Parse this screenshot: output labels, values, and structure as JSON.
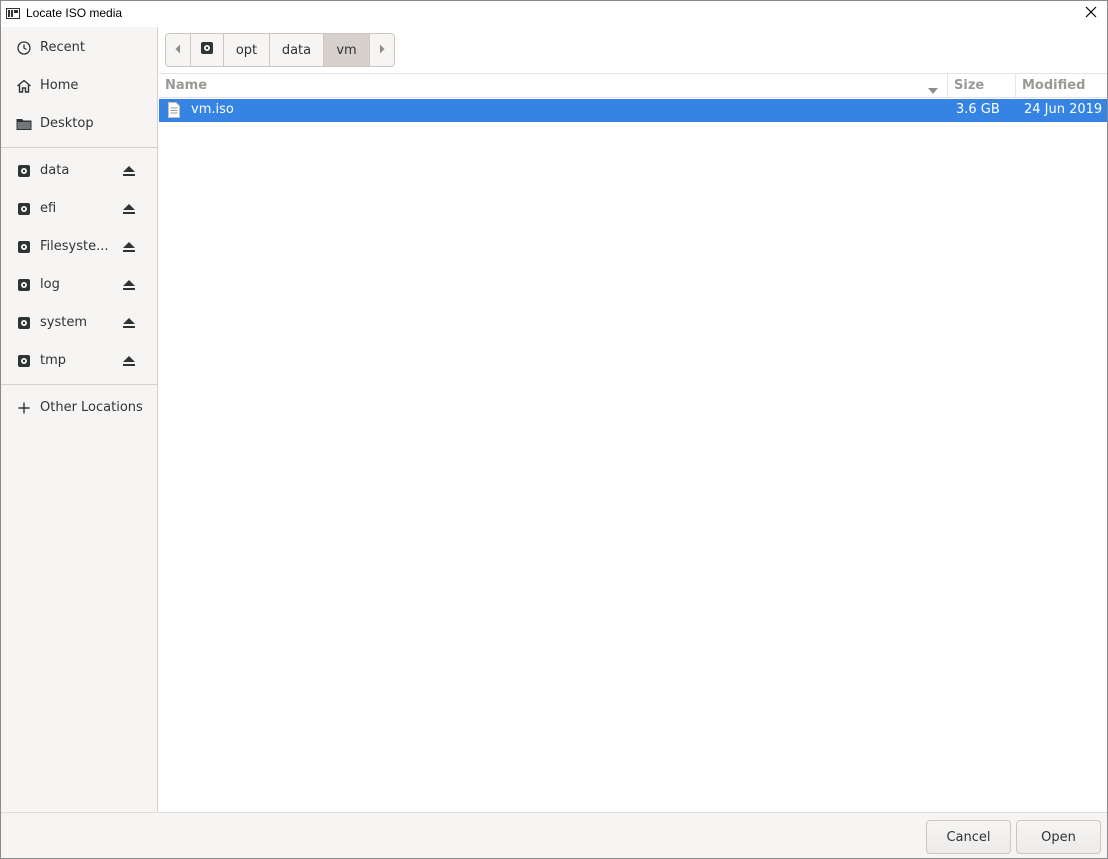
{
  "window": {
    "title": "Locate ISO media",
    "app_icon": "virt-manager-icon",
    "close_icon": "close-icon"
  },
  "sidebar": {
    "places": [
      {
        "label": "Recent",
        "icon": "clock-icon"
      },
      {
        "label": "Home",
        "icon": "home-icon"
      },
      {
        "label": "Desktop",
        "icon": "folder-icon"
      }
    ],
    "devices": [
      {
        "label": "data",
        "icon": "drive-icon",
        "eject": "eject-icon"
      },
      {
        "label": "efi",
        "icon": "drive-icon",
        "eject": "eject-icon"
      },
      {
        "label": "Filesyste...",
        "icon": "drive-icon",
        "eject": "eject-icon"
      },
      {
        "label": "log",
        "icon": "drive-icon",
        "eject": "eject-icon"
      },
      {
        "label": "system",
        "icon": "drive-icon",
        "eject": "eject-icon"
      },
      {
        "label": "tmp",
        "icon": "drive-icon",
        "eject": "eject-icon"
      }
    ],
    "other": {
      "label": "Other Locations",
      "icon": "plus-icon"
    }
  },
  "pathbar": {
    "segments": [
      "opt",
      "data",
      "vm"
    ],
    "active": "vm"
  },
  "filelist": {
    "columns": {
      "name": "Name",
      "size": "Size",
      "modified": "Modified"
    },
    "rows": [
      {
        "name": "vm.iso",
        "size": "3.6 GB",
        "modified": "24 Jun 2019",
        "selected": true
      }
    ]
  },
  "buttons": {
    "cancel": "Cancel",
    "open": "Open"
  },
  "colors": {
    "selection": "#3584e4",
    "sidebar_bg": "#f6f5f4"
  }
}
